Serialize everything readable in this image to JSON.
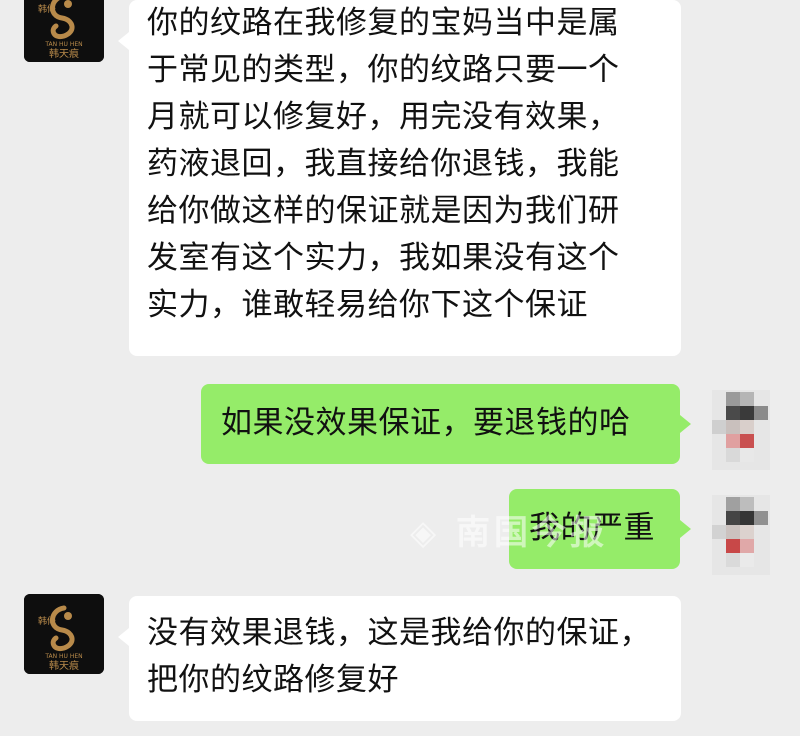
{
  "messages": [
    {
      "sender": "merchant",
      "lines": [
        "你的纹路在我修复的宝妈当中是属",
        "于常见的类型，你的纹路只要一个",
        "月就可以修复好，用完没有效果，",
        "药液退回，我直接给你退钱，我能",
        "给你做这样的保证就是因为我们研",
        "发室有这个实力，我如果没有这个",
        "实力，谁敢轻易给你下这个保证"
      ]
    },
    {
      "sender": "user",
      "lines": [
        "如果没效果保证，要退钱的哈"
      ]
    },
    {
      "sender": "user",
      "lines": [
        "我的严重"
      ]
    },
    {
      "sender": "merchant",
      "lines": [
        "没有效果退钱，这是我给你的保证，",
        "把你的纹路修复好"
      ]
    }
  ],
  "merchant_avatar": {
    "top_text": "韩修",
    "sub_text": "TAN HU HEN",
    "brand_text": "韩天痕"
  },
  "watermark": "◈ 南国今报",
  "colors": {
    "background": "#ededed",
    "incoming_bubble": "#ffffff",
    "outgoing_bubble": "#95ec69",
    "text": "#111111"
  }
}
